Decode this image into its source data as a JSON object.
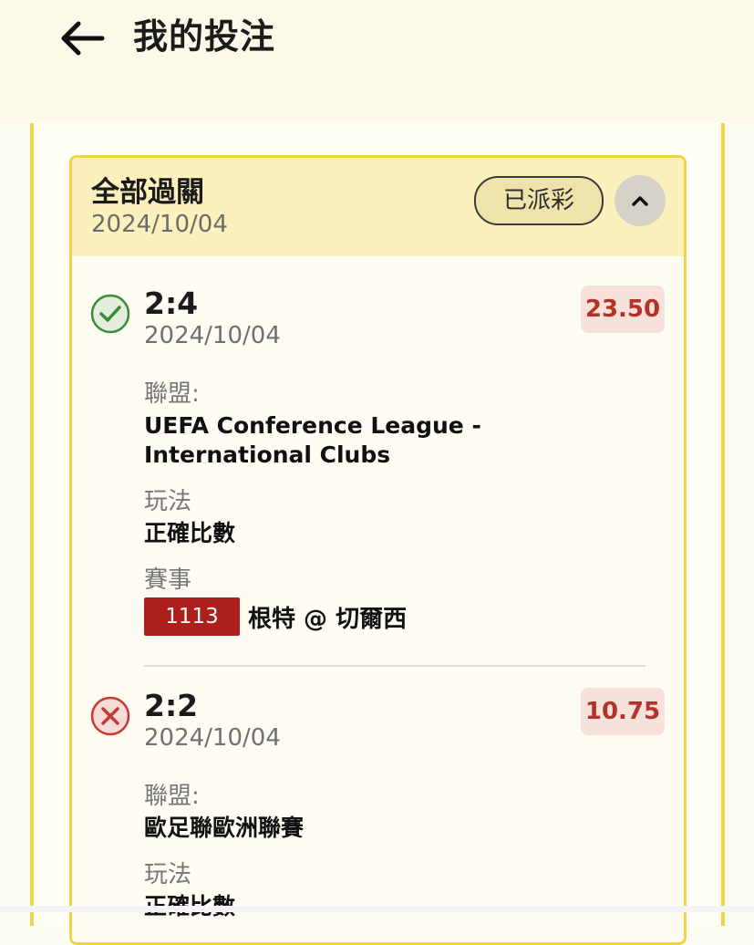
{
  "header": {
    "title": "我的投注",
    "back_icon": "arrow-left-icon"
  },
  "bet": {
    "type": "全部過關",
    "date": "2024/10/04",
    "status": "已派彩",
    "collapse_icon": "chevron-up-icon",
    "legs": [
      {
        "result_icon": "check-circle-icon",
        "result": "won",
        "score": "2:4",
        "date": "2024/10/04",
        "odds": "23.50",
        "league_label": "聯盟:",
        "league_value": "UEFA Conference League - International Clubs",
        "play_label": "玩法",
        "play_value": "正確比數",
        "match_label": "賽事",
        "match_code": "1113",
        "match_name": "根特 @ 切爾西"
      },
      {
        "result_icon": "x-circle-icon",
        "result": "lost",
        "score": "2:2",
        "date": "2024/10/04",
        "odds": "10.75",
        "league_label": "聯盟:",
        "league_value": "歐足聯歐洲聯賽",
        "play_label": "玩法",
        "play_value": "正確比數"
      }
    ]
  },
  "colors": {
    "accent_yellow": "#f1d348",
    "header_bg": "#fcf0bd",
    "odds_text": "#b3322a",
    "match_code_bg": "#ad1f1a",
    "won_green": "#3f8a3a",
    "lost_red": "#c43b35"
  }
}
